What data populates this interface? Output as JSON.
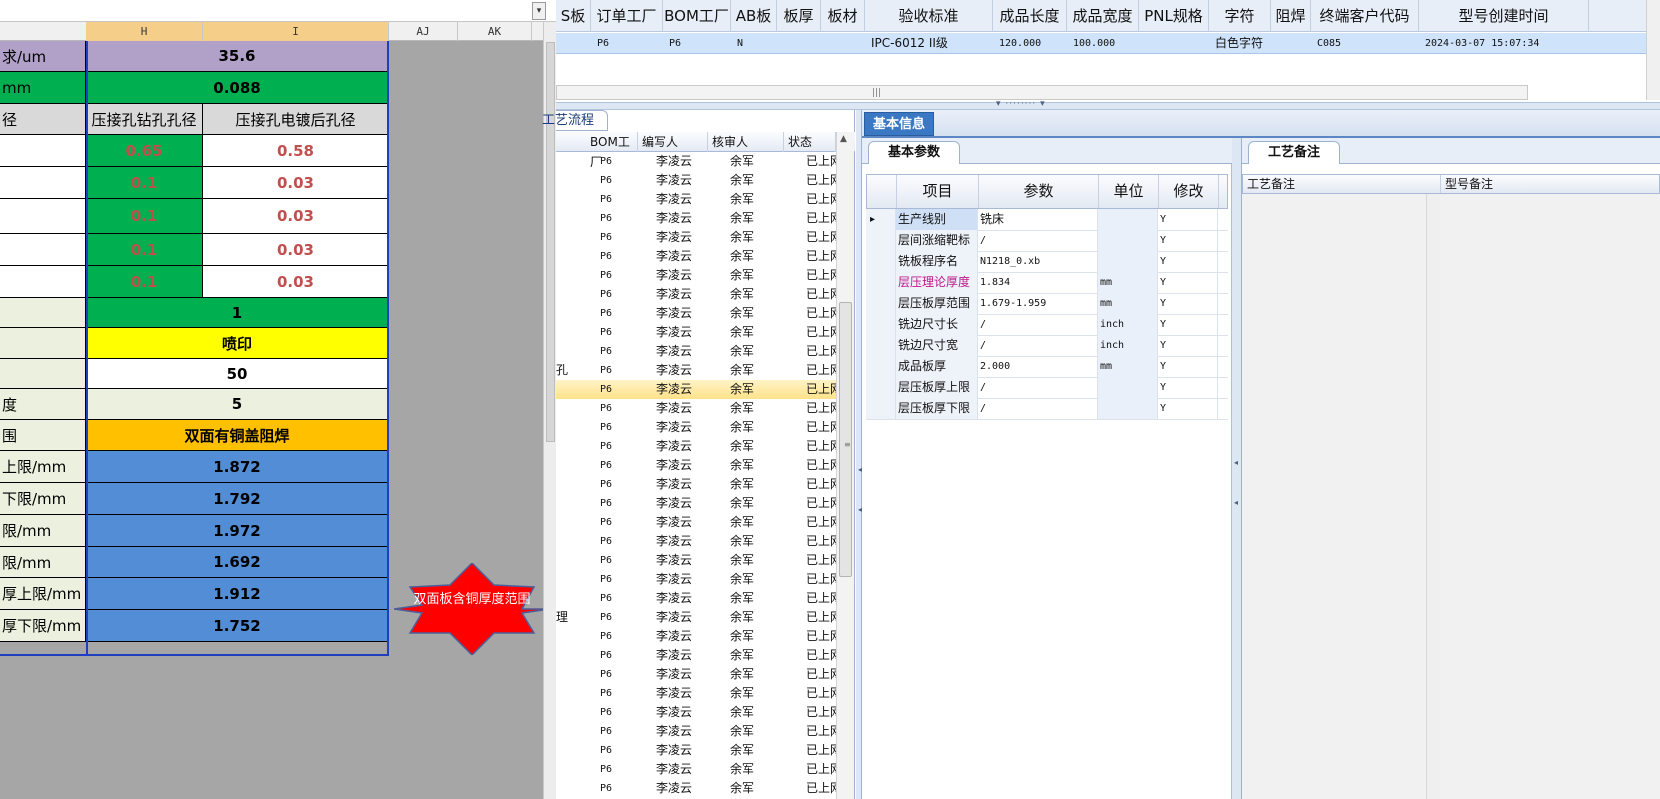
{
  "excel": {
    "column_headers": [
      "H",
      "I",
      "AJ",
      "AK"
    ],
    "rows": [
      {
        "label": "求/um",
        "h": "35.6",
        "i": "",
        "merged": true,
        "label_bg": "#b1a0c7",
        "value_bg": "#b1a0c7",
        "bold": true
      },
      {
        "label": "mm",
        "h": "0.088",
        "i": "",
        "merged": true,
        "label_bg": "#00b050",
        "value_bg": "#00b050",
        "bold": true
      },
      {
        "label": "径",
        "h": "压接孔钻孔孔径",
        "i": "压接孔电镀后孔径",
        "merged": false,
        "label_bg": "#d9d9d9",
        "h_bg": "#d9d9d9",
        "i_bg": "#d9d9d9"
      },
      {
        "label": "",
        "h": "0.65",
        "i": "0.58",
        "merged": false,
        "label_bg": "#ffffff",
        "h_bg": "#00b050",
        "i_bg": "#ffffff",
        "h_color": "#c0504d",
        "i_color": "#c0504d",
        "bold": true
      },
      {
        "label": "",
        "h": "0.1",
        "i": "0.03",
        "merged": false,
        "label_bg": "#ffffff",
        "h_bg": "#00b050",
        "i_bg": "#ffffff",
        "h_color": "#c0504d",
        "i_color": "#c0504d",
        "bold": true
      },
      {
        "label": "",
        "h": "0.1",
        "i": "0.03",
        "merged": false,
        "label_bg": "#ffffff",
        "h_bg": "#00b050",
        "i_bg": "#ffffff",
        "h_color": "#c0504d",
        "i_color": "#c0504d",
        "bold": true
      },
      {
        "label": "",
        "h": "0.1",
        "i": "0.03",
        "merged": false,
        "label_bg": "#ffffff",
        "h_bg": "#00b050",
        "i_bg": "#ffffff",
        "h_color": "#c0504d",
        "i_color": "#c0504d",
        "bold": true
      },
      {
        "label": "",
        "h": "0.1",
        "i": "0.03",
        "merged": false,
        "label_bg": "#ffffff",
        "h_bg": "#00b050",
        "i_bg": "#ffffff",
        "h_color": "#c0504d",
        "i_color": "#c0504d",
        "bold": true
      },
      {
        "label": "",
        "h": "1",
        "i": "",
        "merged": true,
        "label_bg": "#ebf1de",
        "value_bg": "#00b050",
        "bold": true
      },
      {
        "label": "",
        "h": "喷印",
        "i": "",
        "merged": true,
        "label_bg": "#ebf1de",
        "value_bg": "#ffff00",
        "bold": true
      },
      {
        "label": "",
        "h": "50",
        "i": "",
        "merged": true,
        "label_bg": "#ebf1de",
        "value_bg": "#ffffff",
        "bold": true
      },
      {
        "label": "度",
        "h": "5",
        "i": "",
        "merged": true,
        "label_bg": "#ebf1de",
        "value_bg": "#ebf1de",
        "bold": true
      },
      {
        "label": "围",
        "h": "双面有铜盖阻焊",
        "i": "",
        "merged": true,
        "label_bg": "#ebf1de",
        "value_bg": "#ffc000",
        "bold": true
      },
      {
        "label": "上限/mm",
        "h": "1.872",
        "i": "",
        "merged": true,
        "label_bg": "#ebf1de",
        "value_bg": "#538dd5",
        "bold": true
      },
      {
        "label": "下限/mm",
        "h": "1.792",
        "i": "",
        "merged": true,
        "label_bg": "#ebf1de",
        "value_bg": "#538dd5",
        "bold": true
      },
      {
        "label": "限/mm",
        "h": "1.972",
        "i": "",
        "merged": true,
        "label_bg": "#ebf1de",
        "value_bg": "#538dd5",
        "bold": true
      },
      {
        "label": "限/mm",
        "h": "1.692",
        "i": "",
        "merged": true,
        "label_bg": "#ebf1de",
        "value_bg": "#538dd5",
        "bold": true
      },
      {
        "label": "厚上限/mm",
        "h": "1.912",
        "i": "",
        "merged": true,
        "label_bg": "#ebf1de",
        "value_bg": "#538dd5",
        "bold": true
      },
      {
        "label": "厚下限/mm",
        "h": "1.752",
        "i": "",
        "merged": true,
        "label_bg": "#ebf1de",
        "value_bg": "#538dd5",
        "bold": true
      }
    ],
    "callout_text": "双面板含铜厚度范围",
    "callout_color": "#ff0000"
  },
  "top_table": {
    "headers": [
      "S板",
      "订单工厂",
      "BOM工厂",
      "AB板",
      "板厚",
      "板材",
      "验收标准",
      "成品长度",
      "成品宽度",
      "PNL规格",
      "字符",
      "阻焊",
      "终端客户代码",
      "型号创建时间"
    ],
    "row": [
      "",
      "P6",
      "P6",
      "N",
      "",
      "",
      "IPC-6012 II级",
      "120.000",
      "100.000",
      "",
      "白色字符",
      "",
      "C085",
      "2024-03-07 15:07:34"
    ]
  },
  "process": {
    "tab_label": "工艺流程",
    "headers": [
      "BOM工厂",
      "编写人",
      "核审人",
      "状态"
    ],
    "left_fragments": {
      "11": "孔",
      "15": "",
      "21": "",
      "25": "",
      "28": "理",
      "31": "",
      "34": "",
      "22": "",
      "10": ""
    },
    "rows": [
      [
        "P6",
        "李凌云",
        "余军",
        "已上网"
      ],
      [
        "P6",
        "李凌云",
        "余军",
        "已上网"
      ],
      [
        "P6",
        "李凌云",
        "余军",
        "已上网"
      ],
      [
        "P6",
        "李凌云",
        "余军",
        "已上网"
      ],
      [
        "P6",
        "李凌云",
        "余军",
        "已上网"
      ],
      [
        "P6",
        "李凌云",
        "余军",
        "已上网"
      ],
      [
        "P6",
        "李凌云",
        "余军",
        "已上网"
      ],
      [
        "P6",
        "李凌云",
        "余军",
        "已上网"
      ],
      [
        "P6",
        "李凌云",
        "余军",
        "已上网"
      ],
      [
        "P6",
        "李凌云",
        "余军",
        "已上网"
      ],
      [
        "P6",
        "李凌云",
        "余军",
        "已上网"
      ],
      [
        "P6",
        "李凌云",
        "余军",
        "已上网"
      ],
      [
        "P6",
        "李凌云",
        "余军",
        "已上网"
      ],
      [
        "P6",
        "李凌云",
        "余军",
        "已上网"
      ],
      [
        "P6",
        "李凌云",
        "余军",
        "已上网"
      ],
      [
        "P6",
        "李凌云",
        "余军",
        "已上网"
      ],
      [
        "P6",
        "李凌云",
        "余军",
        "已上网"
      ],
      [
        "P6",
        "李凌云",
        "余军",
        "已上网"
      ],
      [
        "P6",
        "李凌云",
        "余军",
        "已上网"
      ],
      [
        "P6",
        "李凌云",
        "余军",
        "已上网"
      ],
      [
        "P6",
        "李凌云",
        "余军",
        "已上网"
      ],
      [
        "P6",
        "李凌云",
        "余军",
        "已上网"
      ],
      [
        "P6",
        "李凌云",
        "余军",
        "已上网"
      ],
      [
        "P6",
        "李凌云",
        "余军",
        "已上网"
      ],
      [
        "P6",
        "李凌云",
        "余军",
        "已上网"
      ],
      [
        "P6",
        "李凌云",
        "余军",
        "已上网"
      ],
      [
        "P6",
        "李凌云",
        "余军",
        "已上网"
      ],
      [
        "P6",
        "李凌云",
        "余军",
        "已上网"
      ],
      [
        "P6",
        "李凌云",
        "余军",
        "已上网"
      ],
      [
        "P6",
        "李凌云",
        "余军",
        "已上网"
      ],
      [
        "P6",
        "李凌云",
        "余军",
        "已上网"
      ],
      [
        "P6",
        "李凌云",
        "余军",
        "已上网"
      ],
      [
        "P6",
        "李凌云",
        "余军",
        "已上网"
      ],
      [
        "P6",
        "李凌云",
        "余军",
        "已上网"
      ]
    ],
    "selected_index": 12,
    "side_labels": [
      "孔",
      "",
      "理",
      ""
    ]
  },
  "basic_info": {
    "tab_label": "基本信息",
    "params_tab": "基本参数",
    "headers": [
      "项目",
      "参数",
      "单位",
      "修改"
    ],
    "rows": [
      {
        "name": "生产线别",
        "value": "铣床",
        "unit": "",
        "mod": "Y"
      },
      {
        "name": "层间涨缩靶标",
        "value": "/",
        "unit": "",
        "mod": "Y"
      },
      {
        "name": "铣板程序名",
        "value": "N1218_0.xb",
        "unit": "",
        "mod": "Y"
      },
      {
        "name": "层压理论厚度",
        "value": "1.834",
        "unit": "mm",
        "mod": "Y"
      },
      {
        "name": "层压板厚范围",
        "value": "1.679-1.959",
        "unit": "mm",
        "mod": "Y"
      },
      {
        "name": "铣边尺寸长",
        "value": "/",
        "unit": "inch",
        "mod": "Y"
      },
      {
        "name": "铣边尺寸宽",
        "value": "/",
        "unit": "inch",
        "mod": "Y"
      },
      {
        "name": "成品板厚",
        "value": "2.000",
        "unit": "mm",
        "mod": "Y"
      },
      {
        "name": "层压板厚上限",
        "value": "/",
        "unit": "",
        "mod": "Y"
      },
      {
        "name": "层压板厚下限",
        "value": "/",
        "unit": "",
        "mod": "Y"
      }
    ],
    "highlight_color": "#c0178a"
  },
  "notes": {
    "tab_label": "工艺备注",
    "headers": [
      "工艺备注",
      "型号备注"
    ]
  },
  "colors": {
    "grid_border": "#1f3fbf",
    "selected_row": "#ffe28a",
    "accent_tab": "#3a78c3"
  }
}
